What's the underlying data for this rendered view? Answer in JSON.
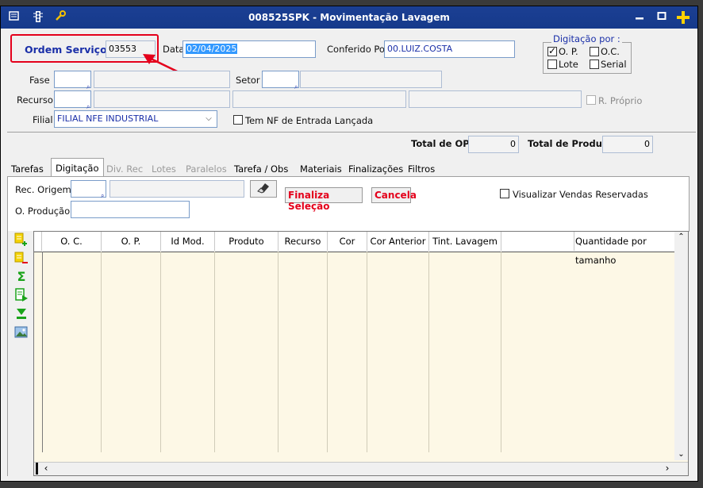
{
  "window": {
    "title": "008525SPK - Movimentação Lavagem"
  },
  "header": {
    "ordem_label": "Ordem Serviço",
    "ordem_value": "03553",
    "data_label": "Data",
    "data_value": "02/04/2025",
    "conferido_label": "Conferido Por",
    "conferido_value": "00.LUIZ.COSTA"
  },
  "digitacao": {
    "title": "Digitação por :",
    "options": [
      {
        "label": "O. P.",
        "checked": true
      },
      {
        "label": "O.C.",
        "checked": false
      },
      {
        "label": "Lote",
        "checked": false
      },
      {
        "label": "Serial",
        "checked": false
      }
    ]
  },
  "form": {
    "fase_label": "Fase",
    "setor_label": "Setor",
    "recurso_label": "Recurso",
    "r_proprio_label": "R. Próprio",
    "filial_label": "Filial",
    "filial_value": "FILIAL NFE INDUSTRIAL",
    "nf_entrada_label": "Tem NF de Entrada Lançada"
  },
  "totals": {
    "total_op_label": "Total de OP ´s",
    "total_op_value": "0",
    "total_produtos_label": "Total de Produtos",
    "total_produtos_value": "0"
  },
  "tabs": [
    {
      "label": "Tarefas",
      "state": "normal"
    },
    {
      "label": "Digitação",
      "state": "active"
    },
    {
      "label": "Div. Rec",
      "state": "disabled"
    },
    {
      "label": "Lotes",
      "state": "disabled"
    },
    {
      "label": "Paralelos",
      "state": "disabled"
    },
    {
      "label": "Tarefa / Obs",
      "state": "normal"
    },
    {
      "label": "Materiais",
      "state": "normal"
    },
    {
      "label": "Finalizações",
      "state": "normal"
    },
    {
      "label": "Filtros",
      "state": "normal"
    }
  ],
  "panel": {
    "rec_origem_label": "Rec. Origem",
    "o_producao_label": "O. Produção",
    "finaliza_label": "Finaliza Seleção",
    "cancela_label": "Cancela",
    "visualizar_label": "Visualizar Vendas Reservadas"
  },
  "grid": {
    "columns": [
      "O. C.",
      "O. P.",
      "Id Mod.",
      "Produto",
      "Recurso",
      "Cor",
      "Cor Anterior",
      "Tint. Lavagem",
      "",
      "Quantidade por tamanho"
    ]
  },
  "icons": [
    "window-menu-icon",
    "traffic-light-icon",
    "wrench-icon",
    "minimize-icon",
    "maximize-icon",
    "add-icon",
    "pick-icon",
    "add-row-icon",
    "remove-row-icon",
    "sum-icon",
    "export-icon",
    "filter-down-icon",
    "image-icon"
  ],
  "colors": {
    "titlebar": "#163a8b",
    "highlight": "#e4001b",
    "grid_bg": "#fdf8e6",
    "selection": "#3399ff"
  }
}
